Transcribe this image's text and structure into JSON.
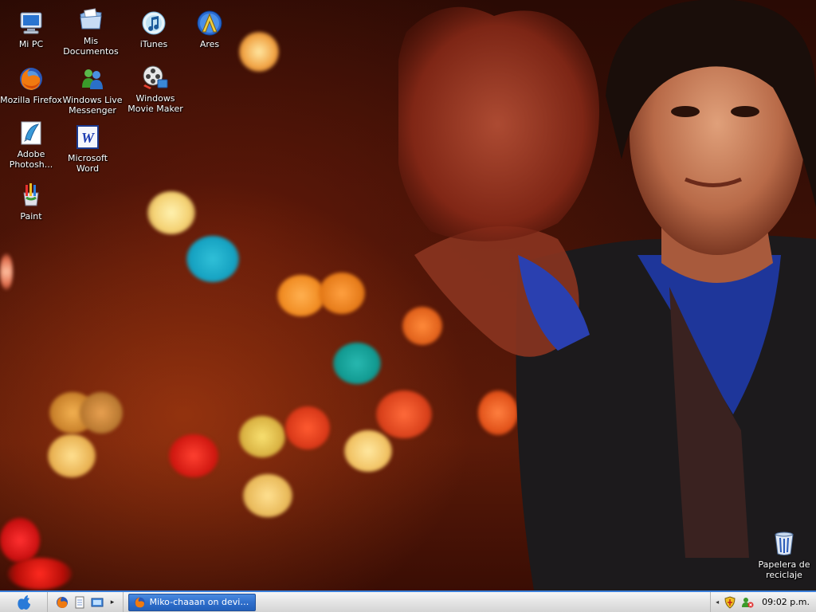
{
  "desktop": {
    "icons": [
      {
        "label": "Mi PC"
      },
      {
        "label": "Mis Documentos"
      },
      {
        "label": "iTunes"
      },
      {
        "label": "Ares"
      },
      {
        "label": "Mozilla Firefox"
      },
      {
        "label": "Windows Live Messenger"
      },
      {
        "label": "Windows Movie Maker"
      },
      {
        "label": "Adobe Photosh..."
      },
      {
        "label": "Microsoft Word"
      },
      {
        "label": "Paint"
      },
      {
        "label": "Papelera de reciclaje"
      }
    ]
  },
  "taskbar": {
    "start_icon": "apple-logo-icon",
    "quick_launch": [
      "firefox-icon",
      "notepad-icon",
      "show-desktop-icon"
    ],
    "tasks": [
      {
        "label": "Miko-chaaan on devian...",
        "icon": "firefox-icon"
      }
    ],
    "tray": {
      "icons": [
        "security-shield-icon",
        "network-users-icon"
      ],
      "clock": "09:02 p.m."
    },
    "accent": "#3b7fd9"
  }
}
